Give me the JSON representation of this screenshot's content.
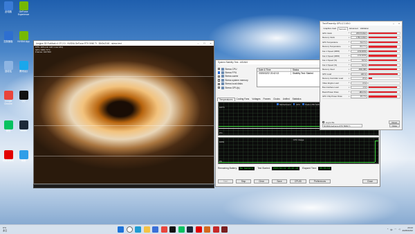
{
  "desktop": {
    "icons": [
      {
        "label": "此电脑",
        "color": "#3a7bd5"
      },
      {
        "label": "GeForce Experience",
        "color": "#76b900"
      },
      {
        "label": "控制面板",
        "color": "#2e6fd0"
      },
      {
        "label": "NVIDIA App",
        "color": "#76b900"
      },
      {
        "label": "回收站",
        "color": "#8db4e2"
      },
      {
        "label": "腾讯QQ",
        "color": "#1aa7ec"
      },
      {
        "label": "Google Chrome",
        "color": "#e8453c"
      },
      {
        "label": "QQ",
        "color": "#111111"
      },
      {
        "label": "微信",
        "color": "#07c160"
      },
      {
        "label": "Steam",
        "color": "#1b2838"
      },
      {
        "label": "网易云音乐",
        "color": "#e20000"
      },
      {
        "label": "画图",
        "color": "#2f9ee8"
      }
    ]
  },
  "benchmark_window": {
    "title": "Unigine 3D FurMark v1.37.2.0 - NVIDIA GeForce RTX 5060 Ti - 3840x2160 - stress test",
    "hud_lines": [
      "FPS: 165  (min 148 / max 181)",
      "GPU: 99%  71°C",
      "Frames: 102 563"
    ]
  },
  "aida_window": {
    "title": "System Stability Test - AIDA64",
    "stress_options": [
      {
        "label": "Stress CPU",
        "checked": false
      },
      {
        "label": "Stress FPU",
        "checked": true
      },
      {
        "label": "Stress cache",
        "checked": false
      },
      {
        "label": "Stress system memory",
        "checked": false
      },
      {
        "label": "Stress local disks",
        "checked": false
      },
      {
        "label": "Stress GPU(s)",
        "checked": false
      }
    ],
    "status_headers": [
      "Date & Time",
      "Status"
    ],
    "status_rows": [
      {
        "time": "2025/02/22 20:42:13",
        "status": "Stability Test: Started"
      }
    ],
    "tabs": [
      "Temperatures",
      "Cooling Fans",
      "Voltages",
      "Powers",
      "Clocks",
      "Unified",
      "Statistics"
    ],
    "active_tab": "Temperatures",
    "temp_graph": {
      "legend": [
        "Motherboard",
        "CPU",
        "Patriot 250 SATA"
      ],
      "axis_top": "100°C",
      "axis_bottom": "0°C"
    },
    "cpu_graph": {
      "title": "CPU Usage",
      "axis_top": "100%",
      "axis_bottom": "0%"
    },
    "remaining_battery_label": "Remaining Battery:",
    "remaining_battery": "No battery",
    "test_started_label": "Test Started:",
    "test_started": "2025/02/22 20:42:13",
    "elapsed_label": "Elapsed Time:",
    "elapsed": "00:00:53",
    "buttons": {
      "start": "Start",
      "stop": "Stop",
      "clear": "Clear",
      "save": "Save",
      "cpuid": "CPUID",
      "preferences": "Preferences",
      "close": "Close"
    }
  },
  "gpuz_window": {
    "title": "TechPowerUp GPU-Z 2.65.0",
    "tabs": [
      "Graphics Card",
      "Sensors",
      "Advanced",
      "Validation"
    ],
    "active_tab": "Sensors",
    "sensors": [
      {
        "label": "GPU Clock",
        "value": "2572.5 MHz",
        "fill": 0.92
      },
      {
        "label": "Memory Clock",
        "value": "1750.1 MHz",
        "fill": 0.9
      },
      {
        "label": "GPU Temperature",
        "value": "72.0 °C",
        "fill": 0.93
      },
      {
        "label": "Memory Temperature",
        "value": "84.0 °C",
        "fill": 0.92
      },
      {
        "label": "Fan 1 Speed (RPM)",
        "value": "1740 RPM",
        "fill": 0.91
      },
      {
        "label": "Fan 2 Speed (RPM)",
        "value": "1740 RPM",
        "fill": 0.91
      },
      {
        "label": "Fan 1 Speed (%)",
        "value": "61 %",
        "fill": 0.9
      },
      {
        "label": "Fan 2 Speed (%)",
        "value": "61 %",
        "fill": 0.9
      },
      {
        "label": "Memory Used",
        "value": "2661 MB",
        "fill": 0.9
      },
      {
        "label": "GPU Load",
        "value": "100 %",
        "fill": 0.93
      },
      {
        "label": "Memory Controller Load",
        "value": "8 %",
        "fill": 0.12
      },
      {
        "label": "Video Engine Load",
        "value": "0 %",
        "fill": 0.0
      },
      {
        "label": "Bus Interface Load",
        "value": "1 %",
        "fill": 0.9
      },
      {
        "label": "Board Power Draw",
        "value": "180.0 W",
        "fill": 0.91
      },
      {
        "label": "GPU Chip Power Draw",
        "value": "98.2 W",
        "fill": 0.9
      }
    ],
    "log_label": "Log to file",
    "reset_label": "Reset",
    "gpu_select": "NVIDIA GeForce RTX 5060 Ti",
    "close_label": "Close"
  },
  "taskbar": {
    "weather_temp": "9°C",
    "weather_desc": "多云",
    "apps": [
      {
        "name": "windows",
        "color": "#1e73d8"
      },
      {
        "name": "search",
        "color": "#ffffff"
      },
      {
        "name": "edge",
        "color": "#1f9bd1"
      },
      {
        "name": "explorer",
        "color": "#f4c244"
      },
      {
        "name": "store",
        "color": "#3a6fd8"
      },
      {
        "name": "chrome",
        "color": "#e8453c"
      },
      {
        "name": "qq",
        "color": "#111111"
      },
      {
        "name": "wechat",
        "color": "#07c160"
      },
      {
        "name": "steam",
        "color": "#1b2838"
      },
      {
        "name": "netease",
        "color": "#e20000"
      },
      {
        "name": "furmark",
        "color": "#d2691e"
      },
      {
        "name": "aida64",
        "color": "#c62828"
      },
      {
        "name": "gpuz",
        "color": "#7a1f1f"
      }
    ],
    "tray_lang": "中",
    "time": "20:43",
    "date": "2025/02/22"
  }
}
